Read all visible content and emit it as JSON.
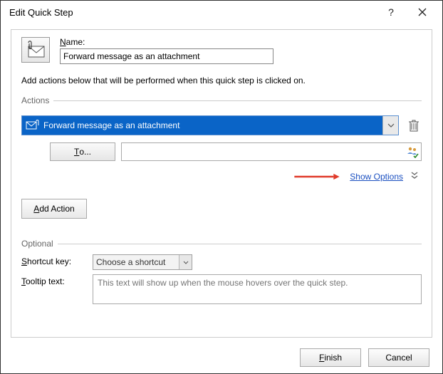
{
  "title": "Edit Quick Step",
  "name_section": {
    "label_pre": "N",
    "label_post": "ame:",
    "value": "Forward message as an attachment"
  },
  "instructions": "Add actions below that will be performed when this quick step is clicked on.",
  "actions_header": "Actions",
  "action": {
    "selected": "Forward message as an attachment",
    "to_label_pre": "T",
    "to_label_post": "o...",
    "to_value": ""
  },
  "show_options": "Show Options",
  "add_action_pre": "A",
  "add_action_post": "dd Action",
  "optional_header": "Optional",
  "shortcut": {
    "label_pre": "S",
    "label_post": "hortcut key:",
    "value": "Choose a shortcut"
  },
  "tooltip": {
    "label_pre": "T",
    "label_post": "ooltip text:",
    "placeholder": "This text will show up when the mouse hovers over the quick step."
  },
  "buttons": {
    "finish_pre": "F",
    "finish_post": "inish",
    "cancel": "Cancel"
  }
}
